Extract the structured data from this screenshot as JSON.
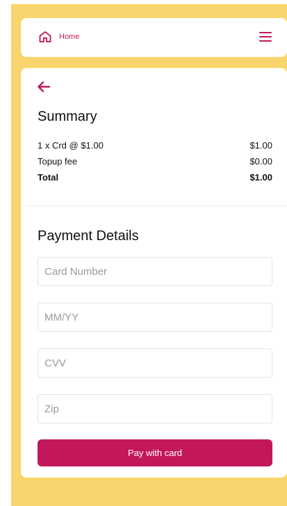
{
  "colors": {
    "accent": "#c2185b",
    "background": "#f8d66d",
    "surface": "#ffffff"
  },
  "nav": {
    "home_icon": "home-icon",
    "home_label": "Home",
    "menu_icon": "hamburger-menu-icon"
  },
  "back_icon": "arrow-left-icon",
  "summary": {
    "title": "Summary",
    "rows": [
      {
        "label": "1 x Crd @ $1.00",
        "amount": "$1.00"
      },
      {
        "label": "Topup fee",
        "amount": "$0.00"
      }
    ],
    "total": {
      "label": "Total",
      "amount": "$1.00"
    }
  },
  "payment": {
    "title": "Payment Details",
    "fields": {
      "card_number": {
        "placeholder": "Card Number",
        "value": ""
      },
      "expiry": {
        "placeholder": "MM/YY",
        "value": ""
      },
      "cvv": {
        "placeholder": "CVV",
        "value": ""
      },
      "zip": {
        "placeholder": "Zip",
        "value": ""
      }
    },
    "submit_label": "Pay with card"
  }
}
